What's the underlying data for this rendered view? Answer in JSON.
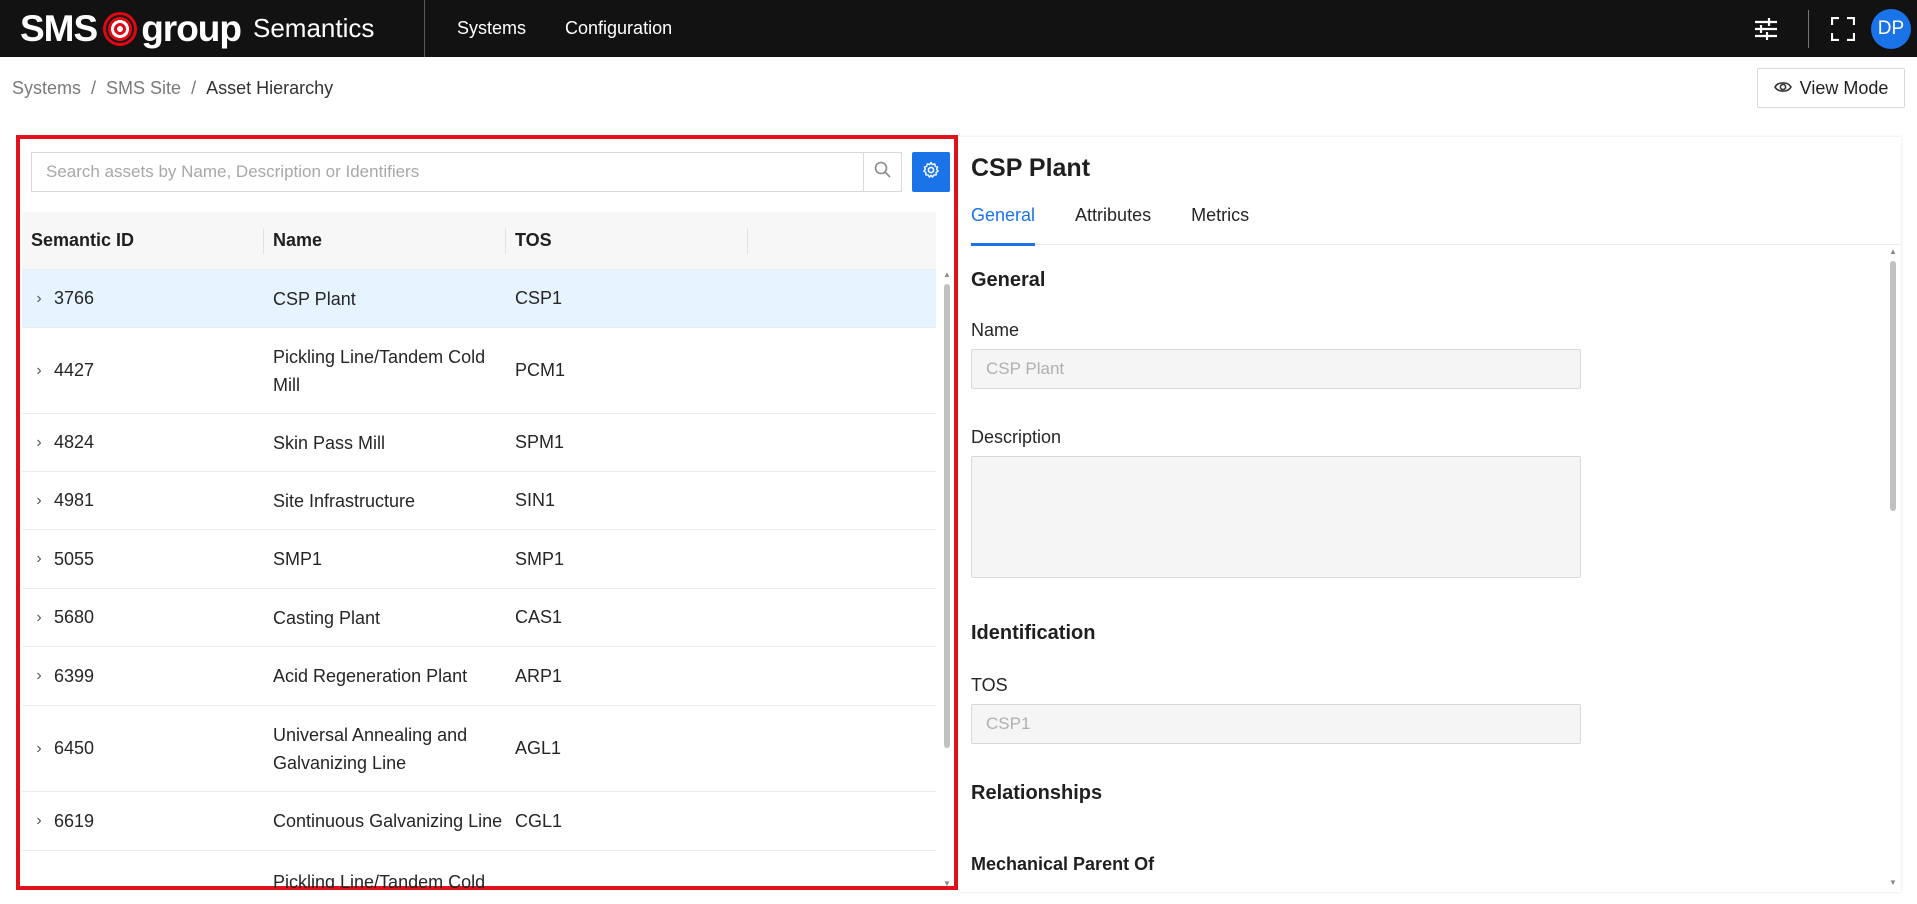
{
  "app": {
    "logo_sms": "SMS",
    "logo_group": "group",
    "product": "Semantics",
    "nav": [
      {
        "label": "Systems"
      },
      {
        "label": "Configuration"
      }
    ],
    "avatar_initials": "DP",
    "accent_color": "#1a73e8",
    "highlight_color": "#e1121b"
  },
  "breadcrumb": {
    "items": [
      "Systems",
      "SMS Site",
      "Asset Hierarchy"
    ],
    "separator": "/"
  },
  "view_mode_label": "View Mode",
  "search": {
    "placeholder": "Search assets by Name, Description or Identifiers",
    "value": ""
  },
  "table": {
    "columns": [
      "Semantic ID",
      "Name",
      "TOS"
    ],
    "rows": [
      {
        "id": "3766",
        "name": "CSP Plant",
        "tos": "CSP1"
      },
      {
        "id": "4427",
        "name": "Pickling Line/Tandem Cold Mill",
        "tos": "PCM1"
      },
      {
        "id": "4824",
        "name": "Skin Pass Mill",
        "tos": "SPM1"
      },
      {
        "id": "4981",
        "name": "Site Infrastructure",
        "tos": "SIN1"
      },
      {
        "id": "5055",
        "name": "SMP1",
        "tos": "SMP1"
      },
      {
        "id": "5680",
        "name": "Casting Plant",
        "tos": "CAS1"
      },
      {
        "id": "6399",
        "name": "Acid Regeneration Plant",
        "tos": "ARP1"
      },
      {
        "id": "6450",
        "name": "Universal Annealing and Galvanizing Line",
        "tos": "AGL1"
      },
      {
        "id": "6619",
        "name": "Continuous Galvanizing Line",
        "tos": "CGL1"
      },
      {
        "id": "",
        "name": "Pickling Line/Tandem Cold",
        "tos": ""
      }
    ]
  },
  "detail": {
    "title": "CSP Plant",
    "tabs": [
      "General",
      "Attributes",
      "Metrics"
    ],
    "active_tab": "General",
    "sections": {
      "general": "General",
      "name_label": "Name",
      "name_value": "CSP Plant",
      "description_label": "Description",
      "description_value": "",
      "identification": "Identification",
      "tos_label": "TOS",
      "tos_value": "CSP1",
      "relationships": "Relationships",
      "mechanical_parent_of": "Mechanical Parent Of"
    }
  }
}
